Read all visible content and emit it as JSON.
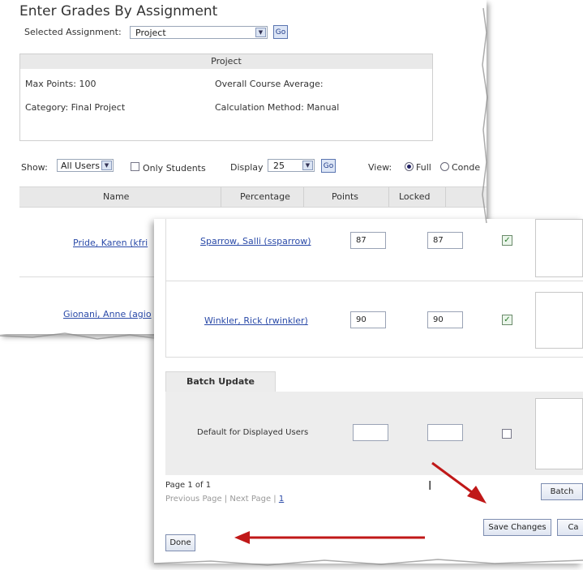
{
  "page": {
    "title": "Enter Grades By Assignment",
    "selected_assignment_label": "Selected Assignment:",
    "selected_assignment_value": "Project",
    "go_label": "Go"
  },
  "info": {
    "header": "Project",
    "max_points": "Max Points: 100",
    "category": "Category: Final Project",
    "overall_average": "Overall Course Average:",
    "calc_method": "Calculation Method: Manual"
  },
  "filters": {
    "show_label": "Show:",
    "show_value": "All Users",
    "only_students_label": "Only Students",
    "display_label": "Display",
    "display_value": "25",
    "go_label": "Go",
    "view_label": "View:",
    "view_full": "Full",
    "view_condensed": "Conde"
  },
  "grid": {
    "columns": [
      "Name",
      "Percentage",
      "Points",
      "Locked"
    ],
    "back_rows": [
      {
        "name": "Pride, Karen (kfri"
      },
      {
        "name": "Gionani, Anne (agio"
      }
    ]
  },
  "front": {
    "rows": [
      {
        "name": "Sparrow, Salli (ssparrow)",
        "percentage": "87",
        "points": "87",
        "locked": true
      },
      {
        "name": "Winkler, Rick (rwinkler)",
        "percentage": "90",
        "points": "90",
        "locked": true
      }
    ],
    "batch": {
      "tab_label": "Batch Update",
      "row_label": "Default for Displayed Users"
    },
    "pager": {
      "page_of": "Page 1 of 1",
      "prev": "Previous Page",
      "divider": "|",
      "next": "Next Page",
      "page_num": "1"
    },
    "buttons": {
      "batch": "Batch",
      "save": "Save Changes",
      "cancel": "Ca",
      "done": "Done"
    }
  },
  "colors": {
    "annotation_arrow": "#c01818",
    "link": "#2a4aa8",
    "header_bg": "#e8e8e8"
  },
  "icons": [
    "dropdown-arrow-icon",
    "check-icon",
    "text-cursor-icon",
    "annotation-arrow-icon"
  ]
}
